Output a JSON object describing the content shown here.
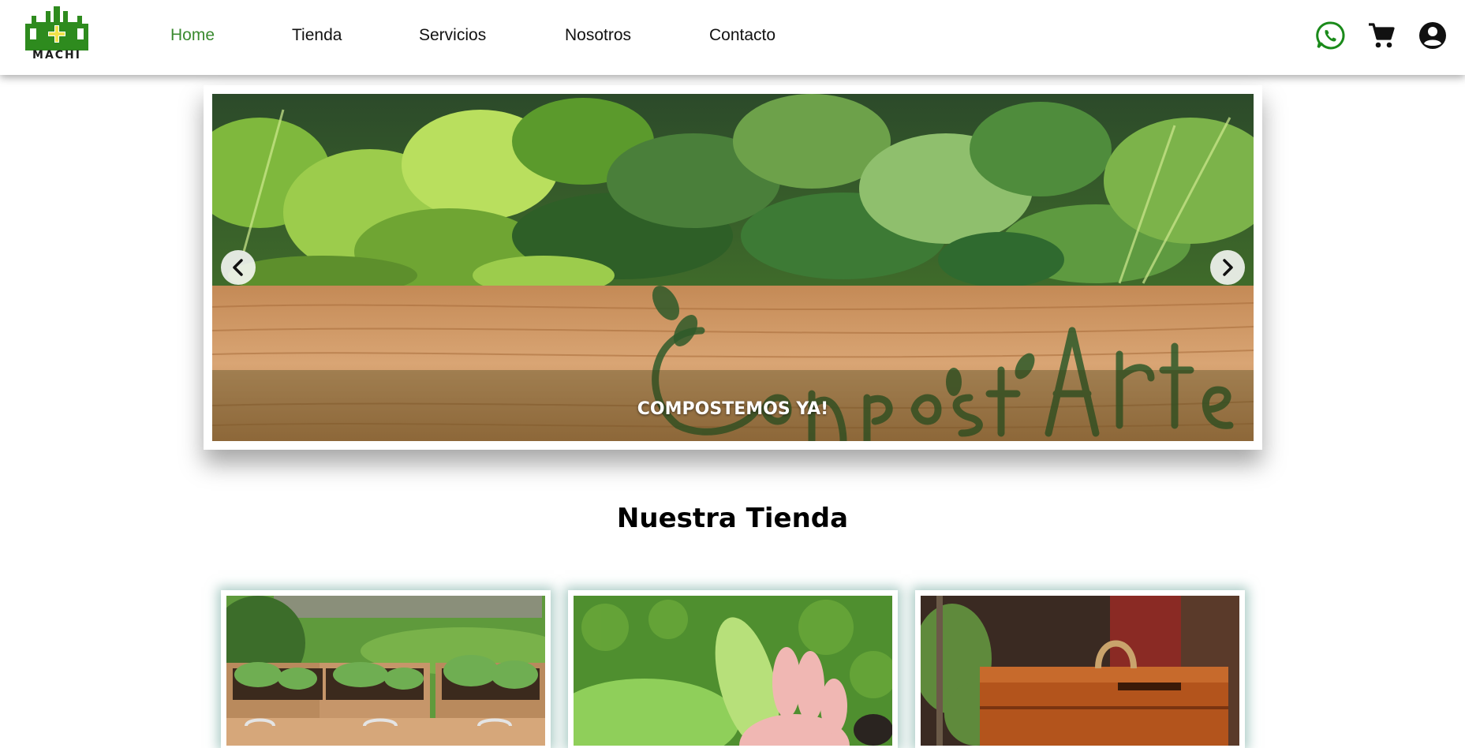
{
  "brand": {
    "name": "MACHI",
    "colors": {
      "primary_green": "#3a8a2f",
      "logo_green": "#2e8b1e",
      "whatsapp_green": "#1a8a1a"
    }
  },
  "nav": {
    "links": [
      {
        "label": "Home",
        "active": true
      },
      {
        "label": "Tienda",
        "active": false
      },
      {
        "label": "Servicios",
        "active": false
      },
      {
        "label": "Nosotros",
        "active": false
      },
      {
        "label": "Contacto",
        "active": false
      }
    ],
    "icons": [
      "whatsapp-icon",
      "cart-icon",
      "account-icon"
    ]
  },
  "carousel": {
    "caption": "COMPOSTEMOS YA!",
    "image_watermark": "CompostArte",
    "prev_icon": "chevron-left-icon",
    "next_icon": "chevron-right-icon"
  },
  "store": {
    "title": "Nuestra Tienda",
    "cards": [
      {
        "image": "raised-planter-boxes-photo"
      },
      {
        "image": "hand-holding-seedling-photo"
      },
      {
        "image": "wooden-compost-bin-photo"
      }
    ]
  }
}
